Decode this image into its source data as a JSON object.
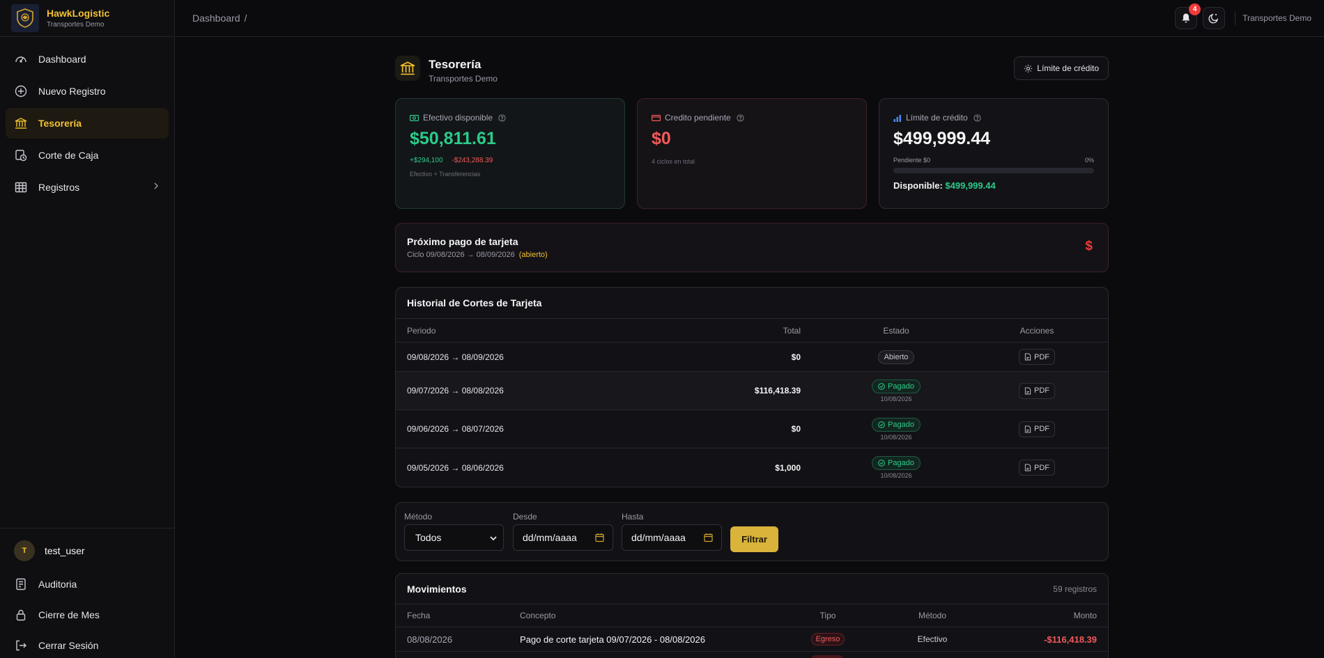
{
  "brand": {
    "name": "HawkLogistic",
    "subtitle": "Transportes Demo"
  },
  "sidebar": {
    "items": [
      {
        "label": "Dashboard",
        "icon": "gauge-icon",
        "active": false
      },
      {
        "label": "Nuevo Registro",
        "icon": "plus-circle-icon",
        "active": false
      },
      {
        "label": "Tesorería",
        "icon": "bank-icon",
        "active": true
      },
      {
        "label": "Corte de Caja",
        "icon": "cash-register-icon",
        "active": false
      },
      {
        "label": "Registros",
        "icon": "table-icon",
        "active": false,
        "has_submenu": true
      }
    ],
    "user": {
      "initial": "T",
      "name": "test_user"
    },
    "bottom_items": [
      {
        "label": "Auditoria",
        "icon": "audit-icon"
      },
      {
        "label": "Cierre de Mes",
        "icon": "lock-icon"
      },
      {
        "label": "Cerrar Sesión",
        "icon": "logout-icon"
      }
    ]
  },
  "topbar": {
    "breadcrumb": "Dashboard",
    "breadcrumb_sep": "/",
    "notifications_count": "4",
    "tenant": "Transportes Demo"
  },
  "page": {
    "title": "Tesorería",
    "subtitle": "Transportes Demo",
    "credit_button": "Límite de crédito"
  },
  "cards": {
    "cash": {
      "label": "Efectivo disponible",
      "value": "$50,811.61",
      "delta_pos": "+$294,100",
      "delta_neg": "-$243,288.39",
      "note": "Efectivo + Transferencias"
    },
    "credit_pending": {
      "label": "Credito pendiente",
      "value": "$0",
      "note": "4 ciclos en total"
    },
    "credit_limit": {
      "label": "Límite de crédito",
      "value": "$499,999.44",
      "pending_label": "Pendiente $0",
      "pending_pct": "0%",
      "usage_fraction": 0,
      "available_label": "Disponible:",
      "available_value": "$499,999.44"
    }
  },
  "next_payment": {
    "title": "Próximo pago de tarjeta",
    "cycle": "Ciclo 09/08/2026 → 08/09/2026",
    "status": "(abierto)",
    "symbol": "$"
  },
  "history": {
    "title": "Historial de Cortes de Tarjeta",
    "headers": {
      "period": "Periodo",
      "total": "Total",
      "status": "Estado",
      "actions": "Acciones"
    },
    "pdf_label": "PDF",
    "rows": [
      {
        "period": "09/08/2026 → 08/09/2026",
        "total": "$0",
        "status": "Abierto",
        "date": ""
      },
      {
        "period": "09/07/2026 → 08/08/2026",
        "total": "$116,418.39",
        "status": "Pagado",
        "date": "10/08/2026"
      },
      {
        "period": "09/06/2026 → 08/07/2026",
        "total": "$0",
        "status": "Pagado",
        "date": "10/08/2026"
      },
      {
        "period": "09/05/2026 → 08/06/2026",
        "total": "$1,000",
        "status": "Pagado",
        "date": "10/08/2026"
      }
    ]
  },
  "filters": {
    "method_label": "Método",
    "method_value": "Todos",
    "from_label": "Desde",
    "from_placeholder": "dd/mm/aaaa",
    "to_label": "Hasta",
    "to_placeholder": "dd/mm/aaaa",
    "button": "Filtrar"
  },
  "movements": {
    "title": "Movimientos",
    "count": "59 registros",
    "headers": {
      "date": "Fecha",
      "concept": "Concepto",
      "type": "Tipo",
      "method": "Método",
      "amount": "Monto"
    },
    "rows": [
      {
        "date": "08/08/2026",
        "concept": "Pago de corte tarjeta 09/07/2026 - 08/08/2026",
        "type": "Egreso",
        "method": "Efectivo",
        "amount": "-$116,418.39"
      }
    ]
  },
  "colors": {
    "accent": "#f2c230",
    "positive": "#2ccb8a",
    "negative": "#f25a5a",
    "background": "#0b0b0e"
  }
}
